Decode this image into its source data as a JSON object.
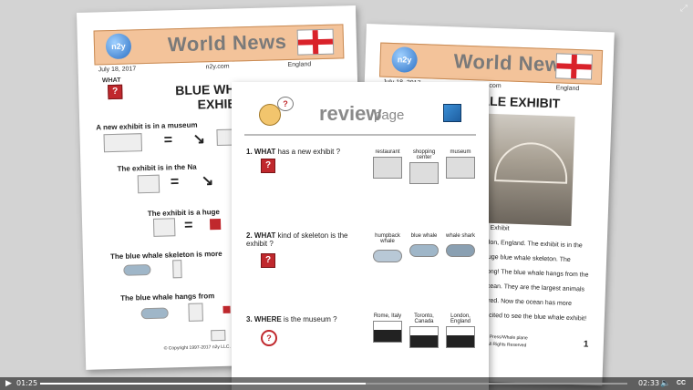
{
  "left_page": {
    "title": "World News",
    "date": "July 18, 2017",
    "site": "n2y.com",
    "country": "England",
    "globe": "n2y",
    "what_label": "WHAT",
    "headline1": "BLUE WHA",
    "headline2": "EXHIB",
    "rows": [
      {
        "text": "A  new  exhibit         is         in  a  museum"
      },
      {
        "text": "The   exhibit     is         in   the  Na"
      },
      {
        "text": "The   exhibit     is    a   huge"
      },
      {
        "text": "The   blue   whale   skeleton   is   more"
      },
      {
        "text": "The   blue   whale   hangs         from"
      }
    ],
    "copyright": "© Copyright 1997-2017 n2y LLC. All"
  },
  "right_page": {
    "title": "World News",
    "date": "July 18, 2017",
    "site": "n2y.com",
    "country": "England",
    "headline": "ALE EXHIBIT",
    "caption": "ale Exhibit",
    "body": [
      "ondon, England.  The exhibit is in the",
      "a huge blue whale skeleton.  The",
      "et long!  The blue whale hangs from the",
      "e ocean.  They are the largest animals",
      "ngered.  Now the ocean has more",
      "e excited to see the blue whale exhibit!"
    ],
    "footer": "ciated Press/Whale plane",
    "footer2": "LLC. All Rights Reserved",
    "page_number": "1"
  },
  "review_page": {
    "review_word": "review",
    "page_word": "page",
    "questions": [
      {
        "num": "1.",
        "wh": "WHAT",
        "rest": "has a new exhibit ?",
        "options": [
          "restaurant",
          "shopping center",
          "museum"
        ]
      },
      {
        "num": "2.",
        "wh": "WHAT",
        "rest": "kind of skeleton is the exhibit ?",
        "options": [
          "humpback whale",
          "blue whale",
          "whale shark"
        ]
      },
      {
        "num": "3.",
        "wh": "WHERE",
        "rest": "is the museum ?",
        "options": [
          "Rome, Italy",
          "Toronto, Canada",
          "London, England"
        ]
      }
    ]
  },
  "player": {
    "current_time": "01:25",
    "duration": "02:33",
    "progress": 0.555,
    "cc": "CC"
  }
}
